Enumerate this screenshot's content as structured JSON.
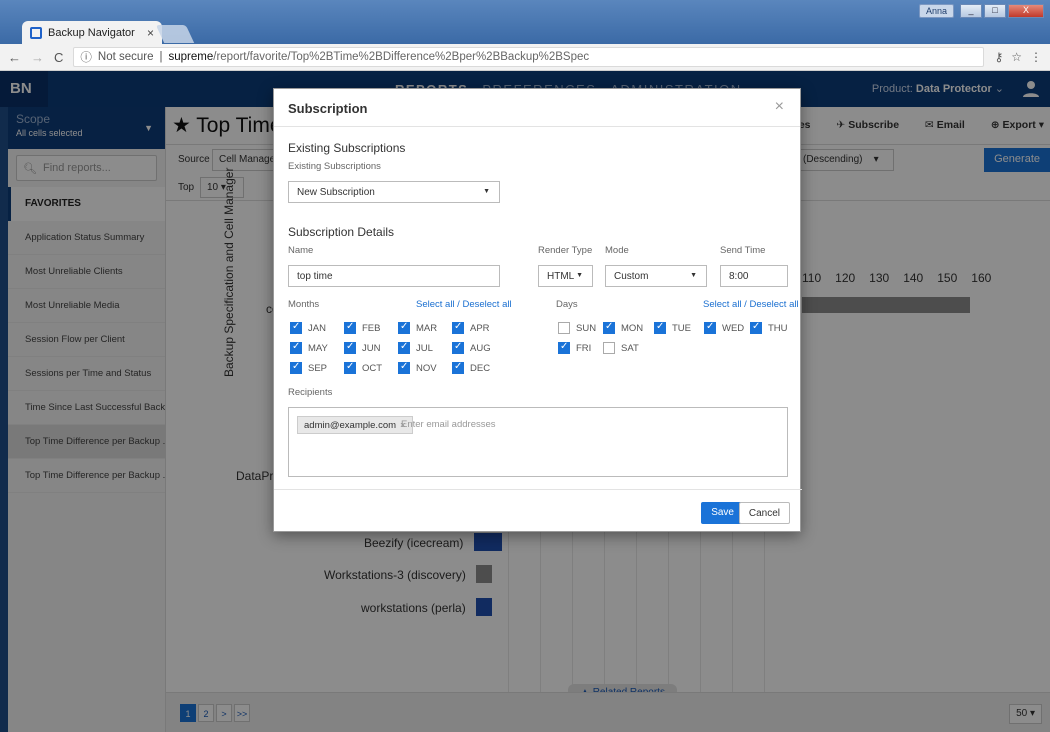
{
  "window": {
    "user": "Anna",
    "tab_title": "Backup Navigator",
    "tab_close": "×",
    "min": "_",
    "max": "□",
    "close": "X"
  },
  "address": {
    "security": "Not secure",
    "host": "supreme",
    "path": "/report/favorite/Top%2BTime%2BDifference%2Bper%2BBackup%2BSpec"
  },
  "header": {
    "logo": "BN",
    "nav": [
      "REPORTS",
      "PREFERENCES",
      "ADMINISTRATION"
    ],
    "product_label": "Product:",
    "product_value": "Data Protector"
  },
  "sidebar": {
    "scope_title": "Scope",
    "scope_sub": "All cells selected",
    "find_placeholder": "Find reports...",
    "favorites": "FAVORITES",
    "items": [
      "Application Status Summary",
      "Most Unreliable Clients",
      "Most Unreliable Media",
      "Session Flow per Client",
      "Sessions per Time and Status",
      "Time Since Last Successful Backup",
      "Top Time Difference per Backup ...",
      "Top Time Difference per Backup ..."
    ]
  },
  "report": {
    "title": "Top Time",
    "actions": [
      "rites",
      "Subscribe",
      "Email",
      "Export"
    ],
    "source_label": "Source",
    "source_value": "Cell Managers",
    "sort_value": "(Descending)",
    "generate": "Generate",
    "top_label": "Top",
    "top_value": "10",
    "y_axis_title": "Backup Specification and Cell Manager",
    "x_ticks": [
      "110",
      "120",
      "130",
      "140",
      "150",
      "160"
    ],
    "categories_visible": [
      "co",
      "DataPro",
      "Beezify (icecream)",
      "Workstations-3 (discovery)",
      "workstations (perla)"
    ],
    "related": "Related Reports",
    "pages": [
      "1",
      "2",
      ">",
      ">>"
    ],
    "per_page": "50"
  },
  "modal": {
    "title": "Subscription",
    "close": "×",
    "existing_section": "Existing Subscriptions",
    "existing_label": "Existing Subscriptions",
    "existing_value": "New Subscription",
    "details_section": "Subscription Details",
    "name_label": "Name",
    "name_value": "top time",
    "render_type_label": "Render Type",
    "render_type_value": "HTML",
    "mode_label": "Mode",
    "mode_value": "Custom",
    "send_time_label": "Send Time",
    "send_time_value": "8:00",
    "months_label": "Months",
    "select_all_months": "Select all / Deselect all",
    "months": [
      {
        "label": "JAN",
        "checked": true
      },
      {
        "label": "FEB",
        "checked": true
      },
      {
        "label": "MAR",
        "checked": true
      },
      {
        "label": "APR",
        "checked": true
      },
      {
        "label": "MAY",
        "checked": true
      },
      {
        "label": "JUN",
        "checked": true
      },
      {
        "label": "JUL",
        "checked": true
      },
      {
        "label": "AUG",
        "checked": true
      },
      {
        "label": "SEP",
        "checked": true
      },
      {
        "label": "OCT",
        "checked": true
      },
      {
        "label": "NOV",
        "checked": true
      },
      {
        "label": "DEC",
        "checked": true
      }
    ],
    "days_label": "Days",
    "select_all_days": "Select all / Deselect all",
    "days": [
      {
        "label": "SUN",
        "checked": false
      },
      {
        "label": "MON",
        "checked": true
      },
      {
        "label": "TUE",
        "checked": true
      },
      {
        "label": "WED",
        "checked": true
      },
      {
        "label": "THU",
        "checked": true
      },
      {
        "label": "FRI",
        "checked": true
      },
      {
        "label": "SAT",
        "checked": false
      }
    ],
    "recipients_label": "Recipients",
    "recipient_chip": "admin@example.com",
    "recipients_placeholder": "Enter email addresses",
    "save": "Save",
    "cancel": "Cancel"
  },
  "colors": {
    "accent": "#1a73d8",
    "header": "#0c3c7a",
    "bar_blue": "#1f4fb0",
    "bar_grey": "#8c8c8c"
  }
}
